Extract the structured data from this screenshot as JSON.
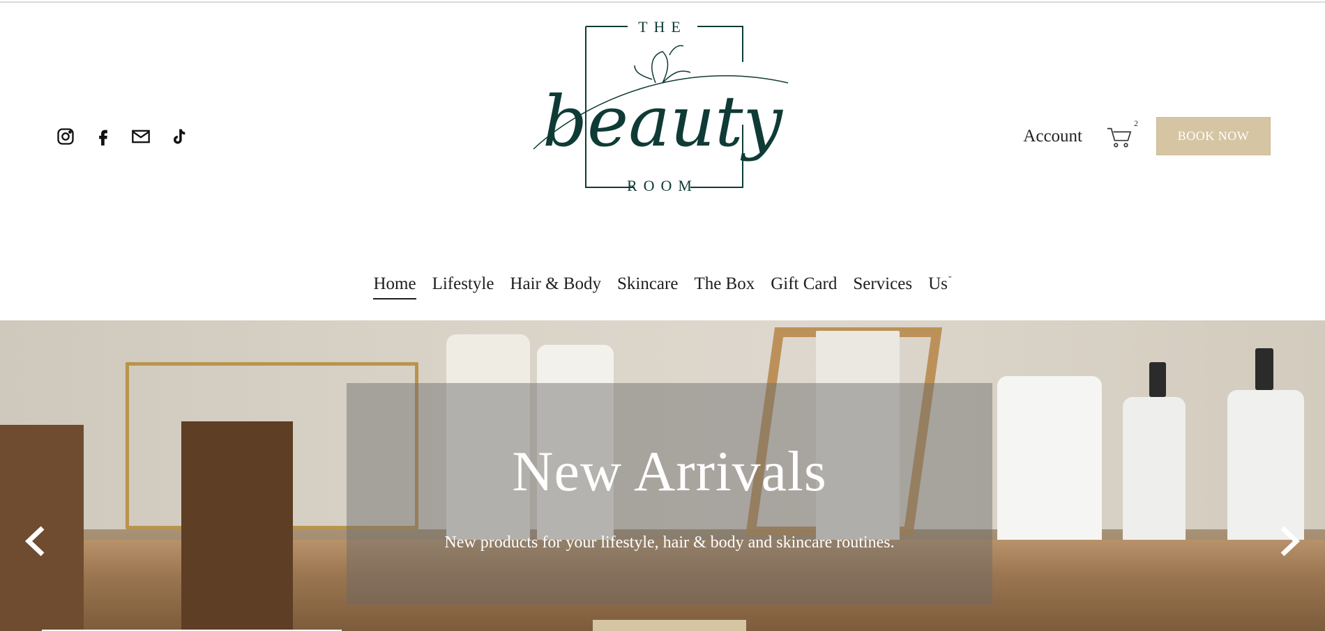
{
  "brand": {
    "top_word": "THE",
    "script_word": "beauty",
    "bottom_word": "ROOM",
    "color": "#0f3b36"
  },
  "social": [
    {
      "icon": "instagram-icon"
    },
    {
      "icon": "facebook-icon"
    },
    {
      "icon": "mail-icon"
    },
    {
      "icon": "tiktok-icon"
    }
  ],
  "header": {
    "account_label": "Account",
    "cart_count": "2",
    "book_label": "BOOK NOW",
    "book_color": "#d5c5a3"
  },
  "nav": {
    "items": [
      {
        "label": "Home",
        "active": true
      },
      {
        "label": "Lifestyle"
      },
      {
        "label": "Hair & Body"
      },
      {
        "label": "Skincare"
      },
      {
        "label": "The Box"
      },
      {
        "label": "Gift Card"
      },
      {
        "label": "Services"
      },
      {
        "label": "Us"
      }
    ]
  },
  "hero": {
    "title": "New Arrivals",
    "subtitle": "New products for your lifestyle, hair & body and skincare routines."
  }
}
